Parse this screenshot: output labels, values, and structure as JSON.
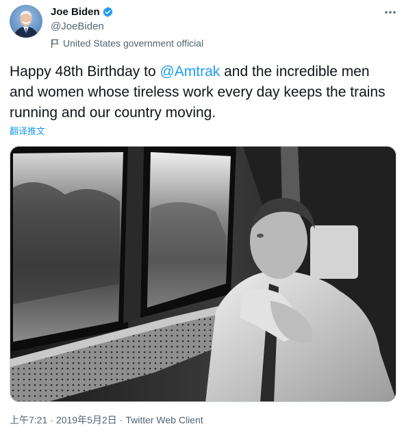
{
  "author": {
    "display_name": "Joe Biden",
    "handle": "@JoeBiden",
    "label": "United States government official",
    "verified": true
  },
  "tweet": {
    "text_before": "Happy 48th Birthday to ",
    "mention": "@Amtrak",
    "text_after": " and the incredible men and women whose tireless work every day keeps the trains running and our country moving.",
    "translate_label": "翻译推文"
  },
  "footer": {
    "time": "上午7:21",
    "separator": "·",
    "date": "2019年5月2日",
    "source": "Twitter Web Client"
  },
  "colors": {
    "accent": "#1d9bf0",
    "text": "#0f1419",
    "secondary": "#536471"
  },
  "icons": {
    "verified": "verified-badge-icon",
    "flag": "flag-icon",
    "more": "more-horizontal-icon"
  }
}
